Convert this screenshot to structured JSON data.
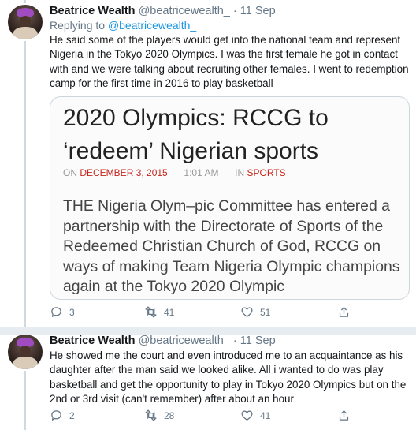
{
  "tweets": [
    {
      "name": "Beatrice Wealth",
      "handle": "@beatricewealth_",
      "time": "· 11 Sep",
      "replying_label": "Replying to",
      "replying_to": "@beatricewealth_",
      "text": "He said some of the players would get into the national team and represent Nigeria in the Tokyo 2020 Olympics. I was the first female he got in contact with and we were talking about recruiting other females. I went to redemption camp for the first time in 2016 to play basketball",
      "card": {
        "title": "2020 Olympics: RCCG to ‘redeem’ Nigerian sports",
        "meta_on": "ON",
        "meta_date": "DECEMBER 3, 2015",
        "meta_time": "1:01 AM",
        "meta_in": "IN",
        "meta_category": "SPORTS",
        "body": "THE Nigeria Olym–pic Committee has entered a partnership with the Directorate of Sports of the Redeemed Christian Church of God, RCCG on ways of making Team Nigeria Olympic champions again at the Tokyo 2020 Olympic"
      },
      "counts": {
        "replies": "3",
        "retweets": "41",
        "likes": "51"
      }
    },
    {
      "name": "Beatrice Wealth",
      "handle": "@beatricewealth_",
      "time": "· 11 Sep",
      "text": "He showed me the court and even introduced me to an acquaintance as his daughter after the man said we looked alike. All i wanted to do was play basketball and get the opportunity to play in Tokyo 2020 Olympics but on the 2nd or 3rd visit (can't remember) after about an hour",
      "counts": {
        "replies": "2",
        "retweets": "28",
        "likes": "41"
      }
    }
  ],
  "icons": {
    "reply": "reply-icon",
    "retweet": "retweet-icon",
    "like": "heart-icon",
    "share": "share-icon"
  },
  "colors": {
    "link": "#1b95e0",
    "muted": "#657786",
    "card_accent": "#c4261d",
    "divider": "#e6ecf0"
  }
}
